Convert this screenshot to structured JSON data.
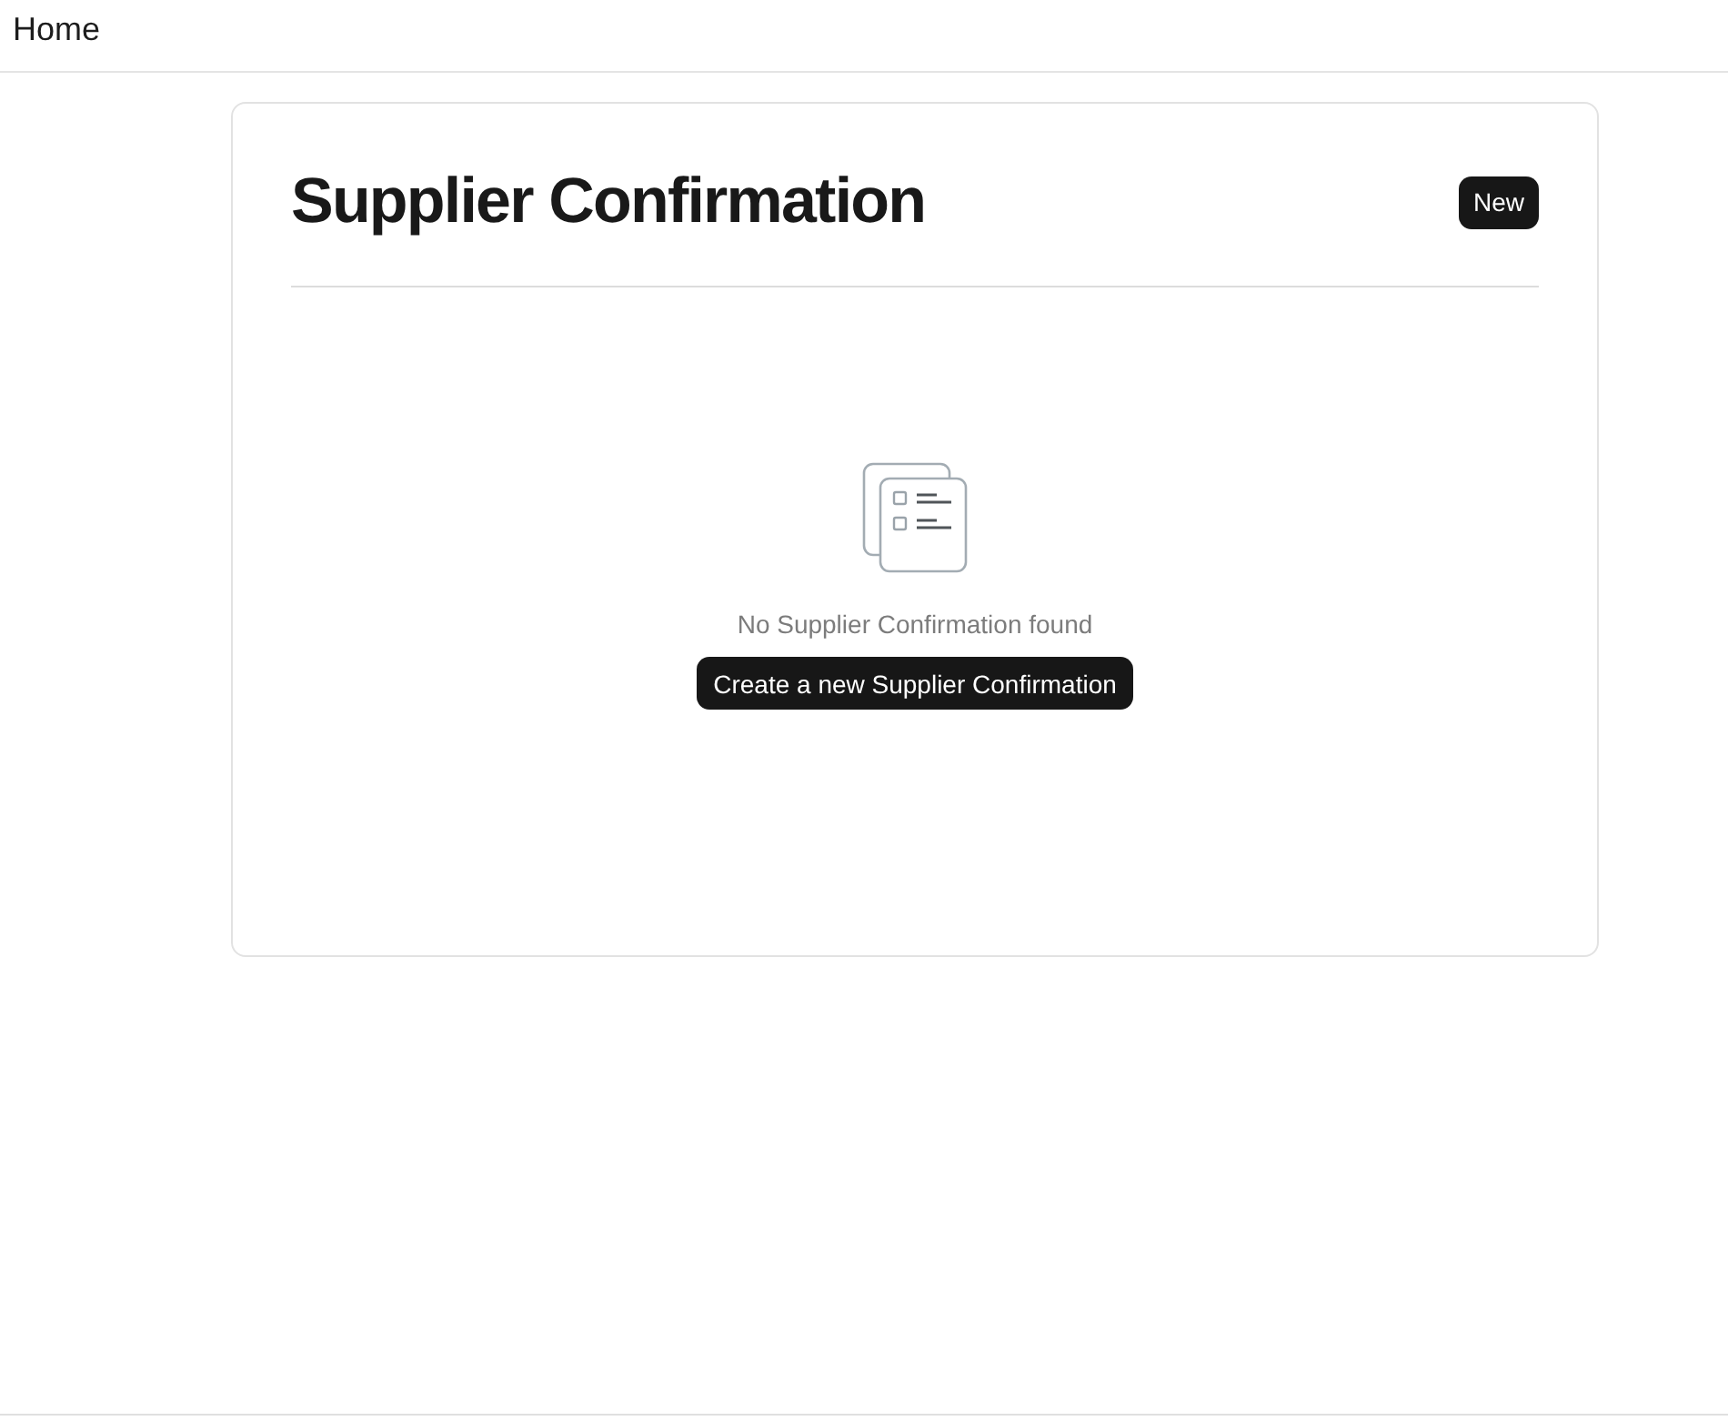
{
  "topbar": {
    "breadcrumb": "Home"
  },
  "page": {
    "title": "Supplier Confirmation",
    "new_button": "New"
  },
  "empty_state": {
    "message": "No Supplier Confirmation found",
    "action": "Create a new Supplier Confirmation"
  }
}
